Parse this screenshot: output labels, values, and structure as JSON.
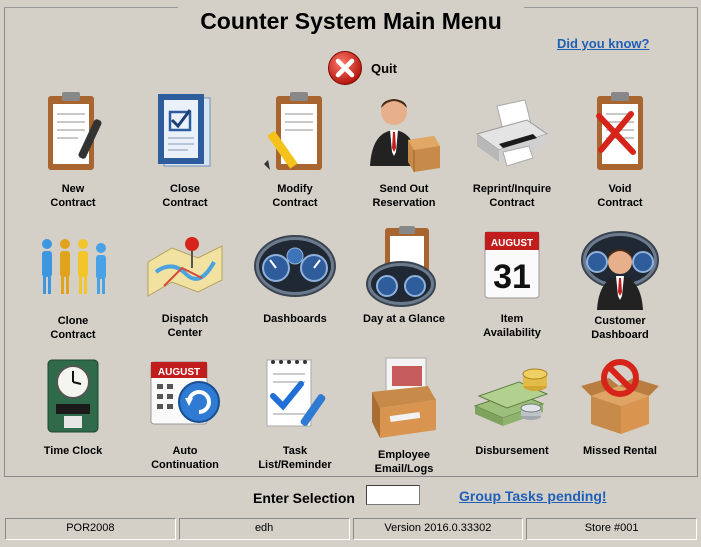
{
  "window": {
    "title": "Counter System Main Menu"
  },
  "links": {
    "did_you_know": "Did you know?",
    "group_tasks": "Group Tasks pending!"
  },
  "quit": {
    "label": "Quit",
    "icon": "quit-x-icon",
    "color": "#d9231c"
  },
  "menu": [
    {
      "label": "New\nContract",
      "icon": "clipboard-pen-icon"
    },
    {
      "label": "Close\nContract",
      "icon": "checked-book-icon"
    },
    {
      "label": "Modify\nContract",
      "icon": "clipboard-pencil-icon"
    },
    {
      "label": "Send Out\nReservation",
      "icon": "person-box-icon"
    },
    {
      "label": "Reprint/Inquire\nContract",
      "icon": "printer-icon"
    },
    {
      "label": "Void\nContract",
      "icon": "clipboard-x-icon"
    },
    {
      "label": "Clone\nContract",
      "icon": "people-clones-icon"
    },
    {
      "label": "Dispatch\nCenter",
      "icon": "map-pin-icon"
    },
    {
      "label": "Dashboards",
      "icon": "gauges-icon"
    },
    {
      "label": "Day at a Glance",
      "icon": "clipboard-gauges-icon"
    },
    {
      "label": "Item\nAvailability",
      "icon": "calendar-31-icon"
    },
    {
      "label": "Customer\nDashboard",
      "icon": "person-gauges-icon"
    },
    {
      "label": "Time Clock",
      "icon": "time-clock-icon"
    },
    {
      "label": "Auto\nContinuation",
      "icon": "calendar-refresh-icon"
    },
    {
      "label": "Task\nList/Reminder",
      "icon": "checklist-icon"
    },
    {
      "label": "Employee\nEmail/Logs",
      "icon": "mail-tray-icon"
    },
    {
      "label": "Disbursement",
      "icon": "money-stack-icon"
    },
    {
      "label": "Missed Rental",
      "icon": "box-no-icon"
    }
  ],
  "footer": {
    "enter_selection": "Enter Selection",
    "input_value": ""
  },
  "status": [
    "POR2008",
    "edh",
    "Version 2016.0.33302",
    "Store #001"
  ],
  "colors": {
    "link": "#1f5fb8",
    "background": "#d4d0c8"
  }
}
